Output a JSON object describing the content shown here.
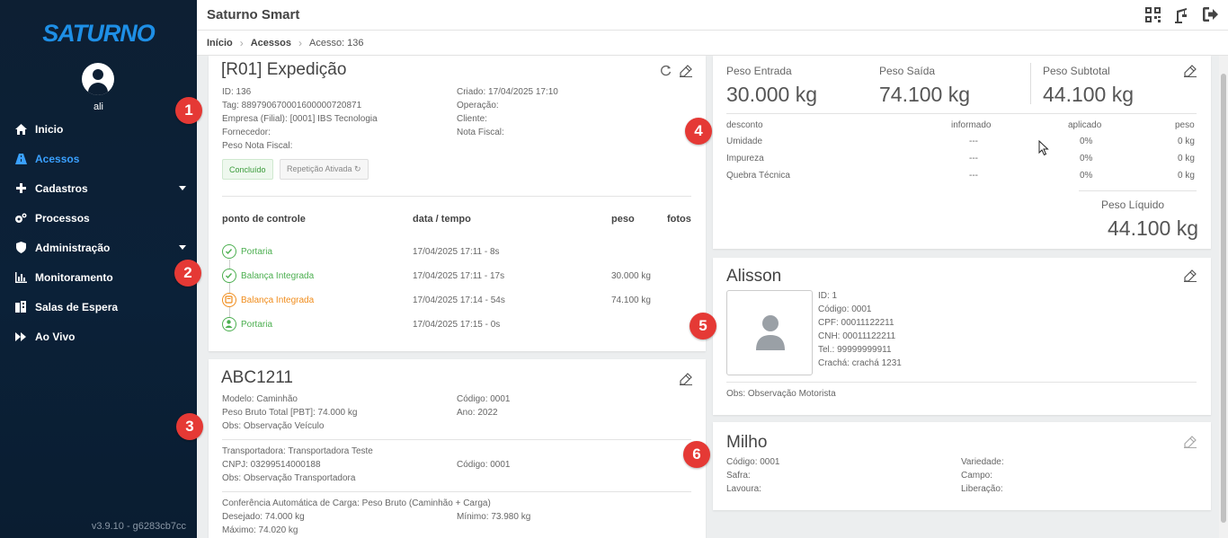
{
  "sidebar": {
    "logo": "SATURNO",
    "username": "ali",
    "items": [
      {
        "label": "Inicio"
      },
      {
        "label": "Acessos"
      },
      {
        "label": "Cadastros"
      },
      {
        "label": "Processos"
      },
      {
        "label": "Administração"
      },
      {
        "label": "Monitoramento"
      },
      {
        "label": "Salas de Espera"
      },
      {
        "label": "Ao Vivo"
      }
    ],
    "version": "v3.9.10 - g6283cb7cc"
  },
  "header": {
    "title": "Saturno Smart"
  },
  "breadcrumb": {
    "home": "Início",
    "section": "Acessos",
    "current": "Acesso: 136"
  },
  "access": {
    "title": "[R01] Expedição",
    "id": "ID: 136",
    "tag": "Tag: 889790670001600000720871",
    "empresa": "Empresa (Filial): [0001] IBS Tecnologia",
    "fornecedor": "Fornecedor:",
    "peso_nf": "Peso Nota Fiscal:",
    "criado": "Criado: 17/04/2025 17:10",
    "operacao": "Operação:",
    "cliente": "Cliente:",
    "nota_fiscal": "Nota Fiscal:",
    "badge_status": "Concluído",
    "badge_repeat": "Repetição Ativada ↻",
    "columns": {
      "ponto": "ponto de controle",
      "data": "data / tempo",
      "peso": "peso",
      "fotos": "fotos"
    },
    "checkpoints": [
      {
        "name": "Portaria",
        "time": "17/04/2025 17:11 - 8s",
        "peso": "",
        "color": "#4caf50"
      },
      {
        "name": "Balança Integrada",
        "time": "17/04/2025 17:11 - 17s",
        "peso": "30.000 kg",
        "color": "#4caf50"
      },
      {
        "name": "Balança Integrada",
        "time": "17/04/2025 17:14 - 54s",
        "peso": "74.100 kg",
        "color": "#f08c1b"
      },
      {
        "name": "Portaria",
        "time": "17/04/2025 17:15 - 0s",
        "peso": "",
        "color": "#4caf50"
      }
    ]
  },
  "vehicle": {
    "plate": "ABC1211",
    "modelo": "Modelo: Caminhão",
    "pbt": "Peso Bruto Total [PBT]: 74.000 kg",
    "obs": "Obs: Observação Veículo",
    "codigo": "Código: 0001",
    "ano": "Ano: 2022",
    "transportadora": "Transportadora: Transportadora Teste",
    "cnpj": "CNPJ: 03299514000188",
    "obs_transp": "Obs: Observação Transportadora",
    "codigo_transp": "Código: 0001",
    "conferencia": "Conferência Automática de Carga: Peso Bruto (Caminhão + Carga)",
    "desejado": "Desejado: 74.000 kg",
    "minimo": "Mínimo: 73.980 kg",
    "maximo": "Máximo: 74.020 kg"
  },
  "weights": {
    "entrada_label": "Peso Entrada",
    "entrada": "30.000 kg",
    "saida_label": "Peso Saída",
    "saida": "74.100 kg",
    "subtotal_label": "Peso Subtotal",
    "subtotal": "44.100 kg",
    "columns": {
      "desconto": "desconto",
      "informado": "informado",
      "aplicado": "aplicado",
      "peso": "peso"
    },
    "rows": [
      {
        "desconto": "Umidade",
        "informado": "---",
        "aplicado": "0%",
        "peso": "0 kg"
      },
      {
        "desconto": "Impureza",
        "informado": "---",
        "aplicado": "0%",
        "peso": "0 kg"
      },
      {
        "desconto": "Quebra Técnica",
        "informado": "---",
        "aplicado": "0%",
        "peso": "0 kg"
      }
    ],
    "liquido_label": "Peso Líquido",
    "liquido": "44.100 kg"
  },
  "driver": {
    "name": "Alisson",
    "id": "ID: 1",
    "codigo": "Código: 0001",
    "cpf": "CPF: 00011122211",
    "cnh": "CNH: 00011122211",
    "tel": "Tel.: 99999999911",
    "cracha": "Crachá: crachá 1231",
    "obs": "Obs: Observação Motorista"
  },
  "product": {
    "name": "Milho",
    "codigo": "Código: 0001",
    "safra": "Safra:",
    "lavoura": "Lavoura:",
    "variedade": "Variedade:",
    "campo": "Campo:",
    "liberacao": "Liberação:"
  },
  "annotations": [
    "1",
    "2",
    "3",
    "4",
    "5",
    "6"
  ],
  "colors": {
    "sidebar": "#0d1f33",
    "accent": "#3aa0ff",
    "success": "#4caf50",
    "warning": "#f08c1b",
    "annotation": "#e53935"
  }
}
